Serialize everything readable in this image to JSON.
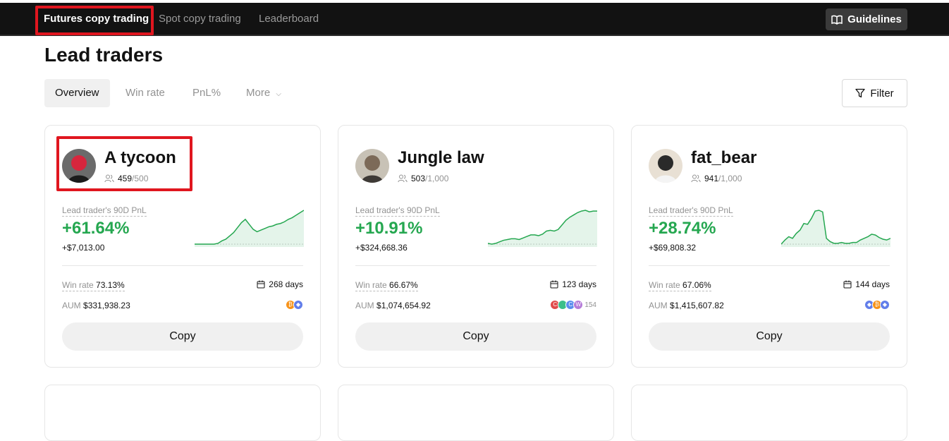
{
  "nav": {
    "tabs": [
      "Futures copy trading",
      "Spot copy trading",
      "Leaderboard"
    ],
    "guidelines_label": "Guidelines"
  },
  "page": {
    "title": "Lead traders"
  },
  "subtabs": [
    "Overview",
    "Win rate",
    "PnL%",
    "More"
  ],
  "filter_label": "Filter",
  "labels": {
    "pnl": "Lead trader's 90D PnL",
    "win_rate": "Win rate",
    "aum": "AUM",
    "copy": "Copy"
  },
  "traders": [
    {
      "name": "A tycoon",
      "followers": "459",
      "max_followers": "/500",
      "pnl_pct": "+61.64%",
      "pnl_amount": "+$7,013.00",
      "win_rate": "73.13%",
      "days": "268 days",
      "aum": "$331,938.23",
      "coins": [
        "btc",
        "eth"
      ],
      "more_coins": "",
      "spark": [
        0,
        0,
        0,
        0,
        0,
        0,
        1,
        4,
        6,
        10,
        14,
        20,
        26,
        30,
        24,
        18,
        15,
        17,
        19,
        21,
        22,
        24,
        25,
        27,
        30,
        32,
        35,
        38,
        41
      ],
      "avatar_colors": [
        "#6b6b6b",
        "#d7263d",
        "#1b1b1b"
      ]
    },
    {
      "name": "Jungle law",
      "followers": "503",
      "max_followers": "/1,000",
      "pnl_pct": "+10.91%",
      "pnl_amount": "+$324,668.36",
      "win_rate": "66.67%",
      "days": "123 days",
      "aum": "$1,074,654.92",
      "coins": [
        "c1",
        "c2",
        "c3",
        "c4"
      ],
      "more_coins": "154",
      "spark": [
        2,
        1,
        2,
        4,
        6,
        7,
        8,
        8,
        7,
        9,
        11,
        13,
        13,
        12,
        14,
        18,
        19,
        18,
        20,
        26,
        32,
        36,
        39,
        42,
        44,
        45,
        43,
        44,
        44
      ],
      "avatar_colors": [
        "#c8c2b6",
        "#7c6a58",
        "#3e3a36"
      ]
    },
    {
      "name": "fat_bear",
      "followers": "941",
      "max_followers": "/1,000",
      "pnl_pct": "+28.74%",
      "pnl_amount": "+$69,808.32",
      "win_rate": "67.06%",
      "days": "144 days",
      "aum": "$1,415,607.82",
      "coins": [
        "eth",
        "btc",
        "eth"
      ],
      "more_coins": "",
      "spark": [
        3,
        8,
        12,
        10,
        16,
        20,
        28,
        27,
        34,
        43,
        44,
        42,
        10,
        6,
        4,
        4,
        5,
        4,
        4,
        5,
        5,
        8,
        10,
        12,
        15,
        14,
        11,
        9,
        8,
        10
      ],
      "avatar_colors": [
        "#e8e0d4",
        "#2a2a2a",
        "#f4f4f4"
      ]
    }
  ],
  "colors": {
    "accent_green": "#25a750",
    "highlight_red": "#e0161f",
    "nav_bg": "#121212"
  }
}
